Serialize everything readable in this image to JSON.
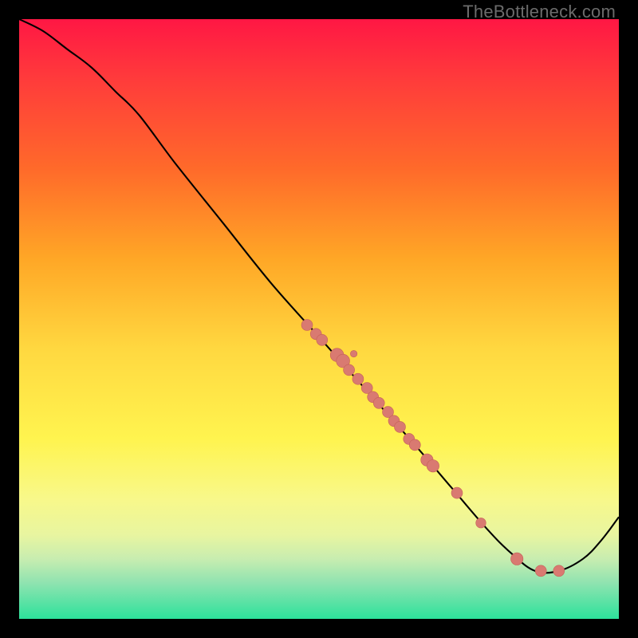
{
  "watermark": "TheBottleneck.com",
  "colors": {
    "frame": "#000000",
    "curve": "#000000",
    "dot_fill": "#d97a71",
    "dot_stroke": "#c56157"
  },
  "chart_data": {
    "type": "line",
    "title": "",
    "xlabel": "",
    "ylabel": "",
    "xlim": [
      0,
      100
    ],
    "ylim": [
      0,
      100
    ],
    "note": "No axes or ticks are visible. x and y below are normalized 0–100 within the inner plot area (0,0 = bottom-left, 100,100 = top-right). The line descends from top-left toward a trough near x≈86 then rises toward the right edge.",
    "series": [
      {
        "name": "bottleneck-curve",
        "x": [
          0,
          4,
          8,
          12,
          16,
          20,
          26,
          34,
          42,
          50,
          58,
          66,
          72,
          78,
          82,
          86,
          90,
          94,
          97,
          100
        ],
        "y": [
          100,
          98,
          95,
          92,
          88,
          84,
          76,
          66,
          56,
          47,
          38,
          29,
          22,
          15,
          11,
          8,
          8,
          10,
          13,
          17
        ]
      }
    ],
    "scatter": {
      "name": "sample-points",
      "note": "Clustered along the mid-lower part of the curve. Same 0–100 normalized coordinates.",
      "points": [
        {
          "x": 48,
          "y": 49,
          "r": 1.0
        },
        {
          "x": 49.5,
          "y": 47.5,
          "r": 1.0
        },
        {
          "x": 50.5,
          "y": 46.5,
          "r": 1.0
        },
        {
          "x": 53,
          "y": 44,
          "r": 1.2
        },
        {
          "x": 54,
          "y": 43,
          "r": 1.2
        },
        {
          "x": 55,
          "y": 41.5,
          "r": 1.0
        },
        {
          "x": 55.8,
          "y": 44.2,
          "r": 0.6
        },
        {
          "x": 56.5,
          "y": 40,
          "r": 1.0
        },
        {
          "x": 58,
          "y": 38.5,
          "r": 1.0
        },
        {
          "x": 59,
          "y": 37,
          "r": 1.0
        },
        {
          "x": 60,
          "y": 36,
          "r": 1.0
        },
        {
          "x": 61.5,
          "y": 34.5,
          "r": 1.0
        },
        {
          "x": 62.5,
          "y": 33,
          "r": 1.0
        },
        {
          "x": 63.5,
          "y": 32,
          "r": 1.0
        },
        {
          "x": 65,
          "y": 30,
          "r": 1.0
        },
        {
          "x": 66,
          "y": 29,
          "r": 1.0
        },
        {
          "x": 68,
          "y": 26.5,
          "r": 1.1
        },
        {
          "x": 69,
          "y": 25.5,
          "r": 1.1
        },
        {
          "x": 73,
          "y": 21,
          "r": 1.0
        },
        {
          "x": 77,
          "y": 16,
          "r": 0.9
        },
        {
          "x": 83,
          "y": 10,
          "r": 1.1
        },
        {
          "x": 87,
          "y": 8,
          "r": 1.0
        },
        {
          "x": 90,
          "y": 8,
          "r": 1.0
        }
      ]
    }
  }
}
